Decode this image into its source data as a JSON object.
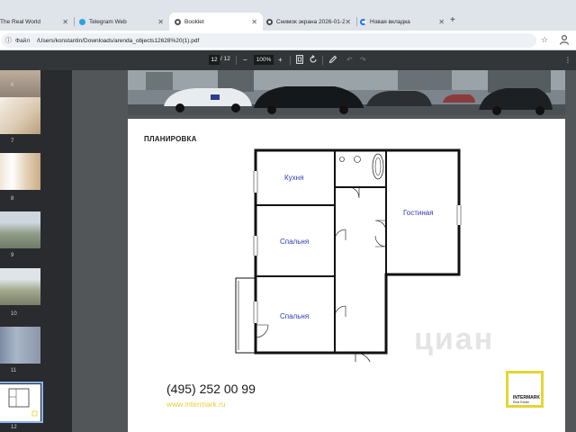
{
  "tabs": [
    {
      "title": "The Real World",
      "color": "#c0392b"
    },
    {
      "title": "Telegram Web",
      "color": "#2aa3e0"
    },
    {
      "title": "Booklet",
      "color": "#555555",
      "active": true
    },
    {
      "title": "Снимок экрана 2026-01-2...",
      "color": "#4b4b4b"
    },
    {
      "title": "Новая вкладка",
      "color": "#1a73e8"
    }
  ],
  "address": {
    "info_icon": "info-icon",
    "label": "Файл",
    "url": "/Users/konstantin/Downloads/arenda_objects12628%20(1).pdf"
  },
  "pdf_toolbar": {
    "page_current": "12",
    "page_sep": "/",
    "page_total": "12",
    "zoom": "100%",
    "minus": "−",
    "plus": "+"
  },
  "thumbnails": [
    {
      "num": "6"
    },
    {
      "num": "7"
    },
    {
      "num": "8"
    },
    {
      "num": "9"
    },
    {
      "num": "10"
    },
    {
      "num": "11"
    },
    {
      "num": "12"
    }
  ],
  "page": {
    "heading": "ПЛАНИРОВКА",
    "rooms": {
      "kitchen": "Кухня",
      "living": "Гостиная",
      "bedroom1": "Спальня",
      "bedroom2": "Спальня"
    },
    "phone": "(495) 252 00 99",
    "website": "www.intermark.ru",
    "logo_name": "INTERMARK",
    "logo_sub": "Real Estate",
    "watermark": "циан"
  },
  "colors": {
    "accent": "#8ab4f8",
    "brand_yellow": "#e5d534",
    "room_label": "#2b3bb0"
  }
}
